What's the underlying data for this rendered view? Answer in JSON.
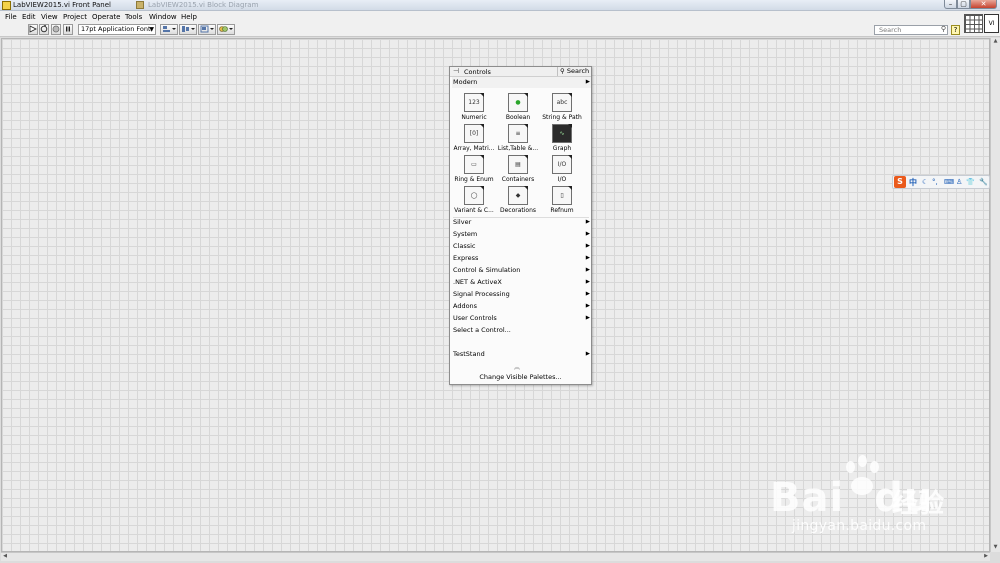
{
  "window": {
    "title": "LabVIEW2015.vi Front Panel",
    "ghost_title": "LabVIEW2015.vi Block Diagram",
    "controls": {
      "minimize": "–",
      "maximize": "▢",
      "close": "✕"
    }
  },
  "menu": [
    "File",
    "Edit",
    "View",
    "Project",
    "Operate",
    "Tools",
    "Window",
    "Help"
  ],
  "toolbar": {
    "run_icon": "run-arrow-icon",
    "font_select": "17pt Application Font",
    "search_placeholder": "Search",
    "help": "?",
    "vi_icon_text": "VI"
  },
  "palette": {
    "title": "Controls",
    "search_label": "Search",
    "modern_label": "Modern",
    "tiles": [
      {
        "label": "Numeric",
        "glyph": "123"
      },
      {
        "label": "Boolean",
        "glyph": "●"
      },
      {
        "label": "String & Path",
        "glyph": "abc"
      },
      {
        "label": "Array, Matri...",
        "glyph": "[0]"
      },
      {
        "label": "List,Table &...",
        "glyph": "≡"
      },
      {
        "label": "Graph",
        "glyph": "∿"
      },
      {
        "label": "Ring & Enum",
        "glyph": "▭"
      },
      {
        "label": "Containers",
        "glyph": "▤"
      },
      {
        "label": "I/O",
        "glyph": "I/O"
      },
      {
        "label": "Variant & C...",
        "glyph": "◯"
      },
      {
        "label": "Decorations",
        "glyph": "◆"
      },
      {
        "label": "Refnum",
        "glyph": "▯"
      }
    ],
    "categories": [
      "Silver",
      "System",
      "Classic",
      "Express",
      "Control & Simulation",
      ".NET & ActiveX",
      "Signal Processing",
      "Addons",
      "User Controls"
    ],
    "select_control": "Select a Control...",
    "teststand": "TestStand",
    "change_visible": "Change Visible Palettes..."
  },
  "ime": {
    "logo": "S",
    "mode": "中"
  },
  "watermark": {
    "brand": "Bai",
    "brand2": "du",
    "product": "经验",
    "url": "jingyan.baidu.com"
  }
}
